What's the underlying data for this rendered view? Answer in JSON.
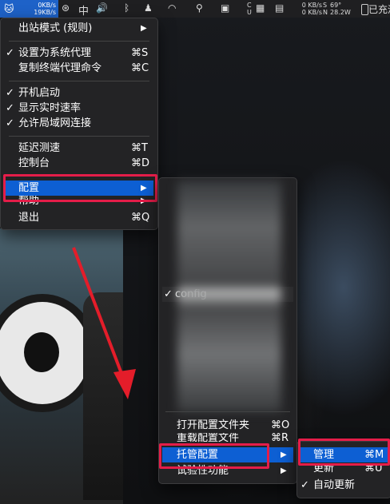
{
  "menubar": {
    "upload_speed": "0KB/s",
    "download_speed": "19KB/s",
    "input_method": "中",
    "net_right_up": "0 KB/s",
    "net_right_down": "0 KB/s",
    "temp": "69°",
    "power": "28.2W",
    "charging_label": "已充满",
    "sensor_labels": [
      "S",
      "N"
    ],
    "storage_labels": [
      "C",
      "U"
    ]
  },
  "main_menu": {
    "items": [
      {
        "label": "出站模式 (规则)",
        "check": "",
        "shortcut": "",
        "arrow": "▶"
      },
      {
        "label": "设置为系统代理",
        "check": "✓",
        "shortcut": "⌘S",
        "arrow": ""
      },
      {
        "label": "复制终端代理命令",
        "check": "",
        "shortcut": "⌘C",
        "arrow": ""
      },
      {
        "label": "开机启动",
        "check": "✓",
        "shortcut": "",
        "arrow": ""
      },
      {
        "label": "显示实时速率",
        "check": "✓",
        "shortcut": "",
        "arrow": ""
      },
      {
        "label": "允许局域网连接",
        "check": "✓",
        "shortcut": "",
        "arrow": ""
      },
      {
        "label": "延迟测速",
        "check": "",
        "shortcut": "⌘T",
        "arrow": ""
      },
      {
        "label": "控制台",
        "check": "",
        "shortcut": "⌘D",
        "arrow": ""
      },
      {
        "label": "配置",
        "check": "",
        "shortcut": "",
        "arrow": "▶"
      },
      {
        "label": "帮助",
        "check": "",
        "shortcut": "",
        "arrow": "▶"
      },
      {
        "label": "退出",
        "check": "",
        "shortcut": "⌘Q",
        "arrow": ""
      }
    ]
  },
  "config_menu": {
    "selected_config": "config",
    "items": [
      {
        "label": "打开配置文件夹",
        "shortcut": "⌘O",
        "arrow": ""
      },
      {
        "label": "重载配置文件",
        "shortcut": "⌘R",
        "arrow": ""
      },
      {
        "label": "托管配置",
        "shortcut": "",
        "arrow": "▶"
      },
      {
        "label": "试验性功能",
        "shortcut": "",
        "arrow": "▶"
      }
    ]
  },
  "managed_menu": {
    "items": [
      {
        "label": "管理",
        "check": "",
        "shortcut": "⌘M"
      },
      {
        "label": "更新",
        "check": "",
        "shortcut": "⌘U"
      },
      {
        "label": "自动更新",
        "check": "✓",
        "shortcut": ""
      }
    ]
  },
  "colors": {
    "highlight": "#0d5fd3",
    "annotation": "#e41d49"
  }
}
